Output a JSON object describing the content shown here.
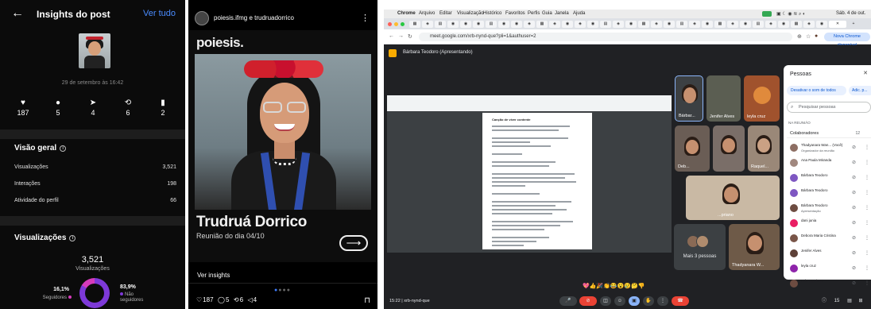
{
  "insights": {
    "title": "Insights do post",
    "see_all": "Ver tudo",
    "date": "29 de setembro às 16:42",
    "stats": [
      {
        "icon": "heart-icon",
        "glyph": "♥",
        "value": "187"
      },
      {
        "icon": "comment-icon",
        "glyph": "●",
        "value": "5"
      },
      {
        "icon": "share-icon",
        "glyph": "➤",
        "value": "4"
      },
      {
        "icon": "repost-icon",
        "glyph": "⟲",
        "value": "6"
      },
      {
        "icon": "bookmark-icon",
        "glyph": "▮",
        "value": "2"
      }
    ],
    "overview": {
      "title": "Visão geral",
      "rows": [
        {
          "label": "Visualizações",
          "value": "3,521"
        },
        {
          "label": "Interações",
          "value": "198"
        },
        {
          "label": "Atividade do perfil",
          "value": "66"
        }
      ]
    },
    "views": {
      "title": "Visualizações",
      "total": "3,521",
      "total_label": "Visualizações",
      "followers_pct": "16,1%",
      "followers_label": "Seguidores",
      "non_followers_pct": "83,9%",
      "non_followers_label": "Não seguidores",
      "non_followers_fraction": 0.839,
      "colors": {
        "non_followers": "#7d39d8",
        "followers": "#d63bbb"
      }
    }
  },
  "post": {
    "accounts": "poiesis.ifmg e trudruadorrico",
    "brand": "poiesis.",
    "name": "Trudruá Dorrico",
    "subtitle": "Reunião do dia 04/10",
    "see_insights": "Ver insights",
    "likes": "187",
    "comments": "5",
    "reposts": "6",
    "shares": "4"
  },
  "meet": {
    "mac_menu": [
      "Chrome",
      "Arquivo",
      "Editar",
      "Visualização",
      "Histórico",
      "Favoritos",
      "Perfis",
      "Guia",
      "Janela",
      "Ajuda"
    ],
    "clock": "Sáb. 4 de out.",
    "url": "meet.google.com/xrb-nynd-que?pli=1&authuser=2",
    "new_chrome": "Nova Chrome disponível",
    "presenter": "Bárbara Teodoro (Apresentando)",
    "doc_title": "Canção de viver contente",
    "tiles": [
      {
        "label": "Bárbar..."
      },
      {
        "label": "Jenifer Alves"
      },
      {
        "label": "leyla cruz"
      },
      {
        "label": "Deb..."
      },
      {
        "label": "Raquel..."
      },
      {
        "label": "Lo..."
      },
      {
        "label": "...priano"
      },
      {
        "label": "Thadyanara W..."
      }
    ],
    "more_people": "Mais 3 pessoas",
    "panel": {
      "title": "Pessoas",
      "mute_all": "Desativar o som de todos",
      "add": "Adic. p...",
      "search_placeholder": "Pesquisar pessoas",
      "section": "NA REUNIÃO",
      "collaborators": "Colaboradores",
      "collab_count": "12",
      "people": [
        {
          "name": "Thadyanara Wan... (Você)",
          "sub": "Organizador da reunião",
          "color": "#8d6e63"
        },
        {
          "name": "Ana Paula Miranda",
          "sub": "",
          "color": "#a1887f"
        },
        {
          "name": "Bárbara Teodoro",
          "sub": "",
          "color": "#7e57c2"
        },
        {
          "name": "Bárbara Teodoro",
          "sub": "",
          "color": "#7e57c2"
        },
        {
          "name": "Bárbara Teodoro",
          "sub": "Apresentação",
          "color": "#6d4c41"
        },
        {
          "name": "dani junia",
          "sub": "",
          "color": "#e91e63"
        },
        {
          "name": "Debora Maria Cristina",
          "sub": "",
          "color": "#795548"
        },
        {
          "name": "Jenifer Alves",
          "sub": "",
          "color": "#5d4037"
        },
        {
          "name": "leyla cruz",
          "sub": "",
          "color": "#8e24aa"
        },
        {
          "name": "Lola Cypriano",
          "sub": "",
          "color": "#6d4c41"
        }
      ]
    },
    "time": "15:22",
    "meeting_code": "xrb-nynd-que",
    "participants_badge": "15"
  }
}
